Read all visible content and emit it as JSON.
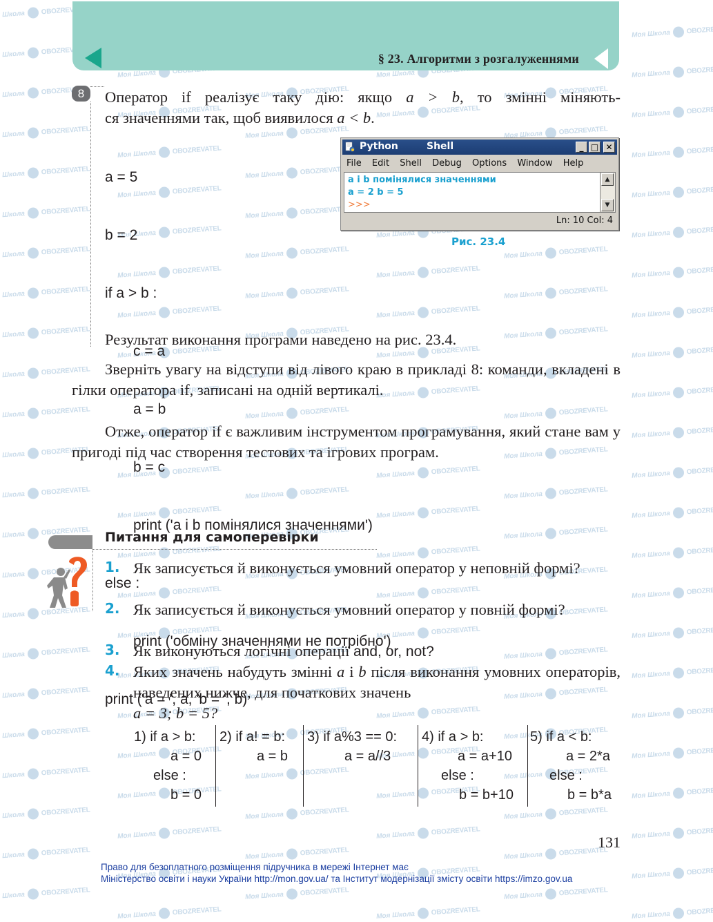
{
  "header": {
    "section_title": "§ 23. Алгоритми з розгалуженнями"
  },
  "example": {
    "number": "8",
    "intro_line1": "Оператор if реалізує таку дію: якщо",
    "intro_cond1": "a > b",
    "intro_line1_end": ", то змінні міняють-",
    "intro_line2": "ся значеннями так, щоб виявилося",
    "intro_cond2": "a < b",
    "intro_line2_end": ".",
    "code_lines": [
      {
        "text": "a = 5",
        "indent": false
      },
      {
        "text": "b = 2",
        "indent": false
      },
      {
        "text": "if a > b :",
        "indent": false
      },
      {
        "text": "c = a",
        "indent": true
      },
      {
        "text": "a = b",
        "indent": true
      },
      {
        "text": "b = c",
        "indent": true
      },
      {
        "text": "print ('a i b помінялися значеннями')",
        "indent": true
      },
      {
        "text": "else :",
        "indent": false
      },
      {
        "text": "print ('обміну значеннями не потрібно')",
        "indent": true
      },
      {
        "text": "print ('a = ', a, 'b = ', b)",
        "indent": false
      }
    ],
    "result_text": "Результат виконання програми наведено на рис. 23.4."
  },
  "python_shell": {
    "title_left": "Python",
    "title_right": "Shell",
    "buttons": {
      "minimize": "_",
      "maximize": "□",
      "close": "✕"
    },
    "menu": [
      "File",
      "Edit",
      "Shell",
      "Debug",
      "Options",
      "Window",
      "Help"
    ],
    "output_lines": [
      "a i b помінялися значеннями",
      "a = 2  b = 5"
    ],
    "prompt": ">>>",
    "status": "Ln: 10   Col: 4",
    "caption": "Рис. 23.4"
  },
  "body": {
    "para1": "Зверніть увагу на відступи від лівого краю в прикладі 8: команди, вкладені в гілки оператора if, записані на одній вертикалі.",
    "para2": "Отже, оператор if є важливим інструментом програмування, який стане вам у пригоді під час створення тестових та ігрових програм."
  },
  "questions": {
    "title": "Питання для самоперевірки",
    "items": [
      {
        "num": "1.",
        "text": "Як записується й виконується умовний оператор у неповній формі?"
      },
      {
        "num": "2.",
        "text": "Як записується й виконується умовний оператор у повній формі?"
      },
      {
        "num": "3.",
        "text_before": "Як виконуються логічні операції",
        "text_code": "and, or, not?"
      },
      {
        "num": "4.",
        "text_a": "Яких значень набудуть змінні",
        "var_a": "a",
        "text_i": "і",
        "var_b": "b",
        "text_b": "після виконання умовних операторів, наведених нижче, для початкових значень",
        "init": "a = 3;  b = 5?"
      }
    ],
    "operators": [
      {
        "lines": [
          "1) if a > b:",
          "a = 0",
          "else :",
          "b = 0"
        ]
      },
      {
        "lines": [
          "2) if a! = b:",
          "a = b"
        ]
      },
      {
        "lines": [
          "3) if a%3 == 0:",
          "a = a//3"
        ]
      },
      {
        "lines": [
          "4) if a > b:",
          "a = a+10",
          "else :",
          "b = b+10"
        ]
      },
      {
        "lines": [
          "5) if a < b:",
          "a = 2*a",
          "else :",
          "b = b*a"
        ]
      }
    ]
  },
  "page_number": "131",
  "footer": {
    "line1": "Право для безоплатного розміщення підручника в мережі Інтернет має",
    "line2": "Міністерство освіти і науки України http://mon.gov.ua/ та Інститут модернізації змісту освіти https://imzo.gov.ua"
  },
  "watermark": {
    "left": "Моя Школа",
    "right": "OBOZREVATEL"
  },
  "colors": {
    "header_bg": "#96d3c8",
    "accent_teal": "#1aa68c",
    "accent_blue": "#1aa0cf",
    "prompt_orange": "#f07c3a",
    "question_mark": "#ee5a24"
  }
}
